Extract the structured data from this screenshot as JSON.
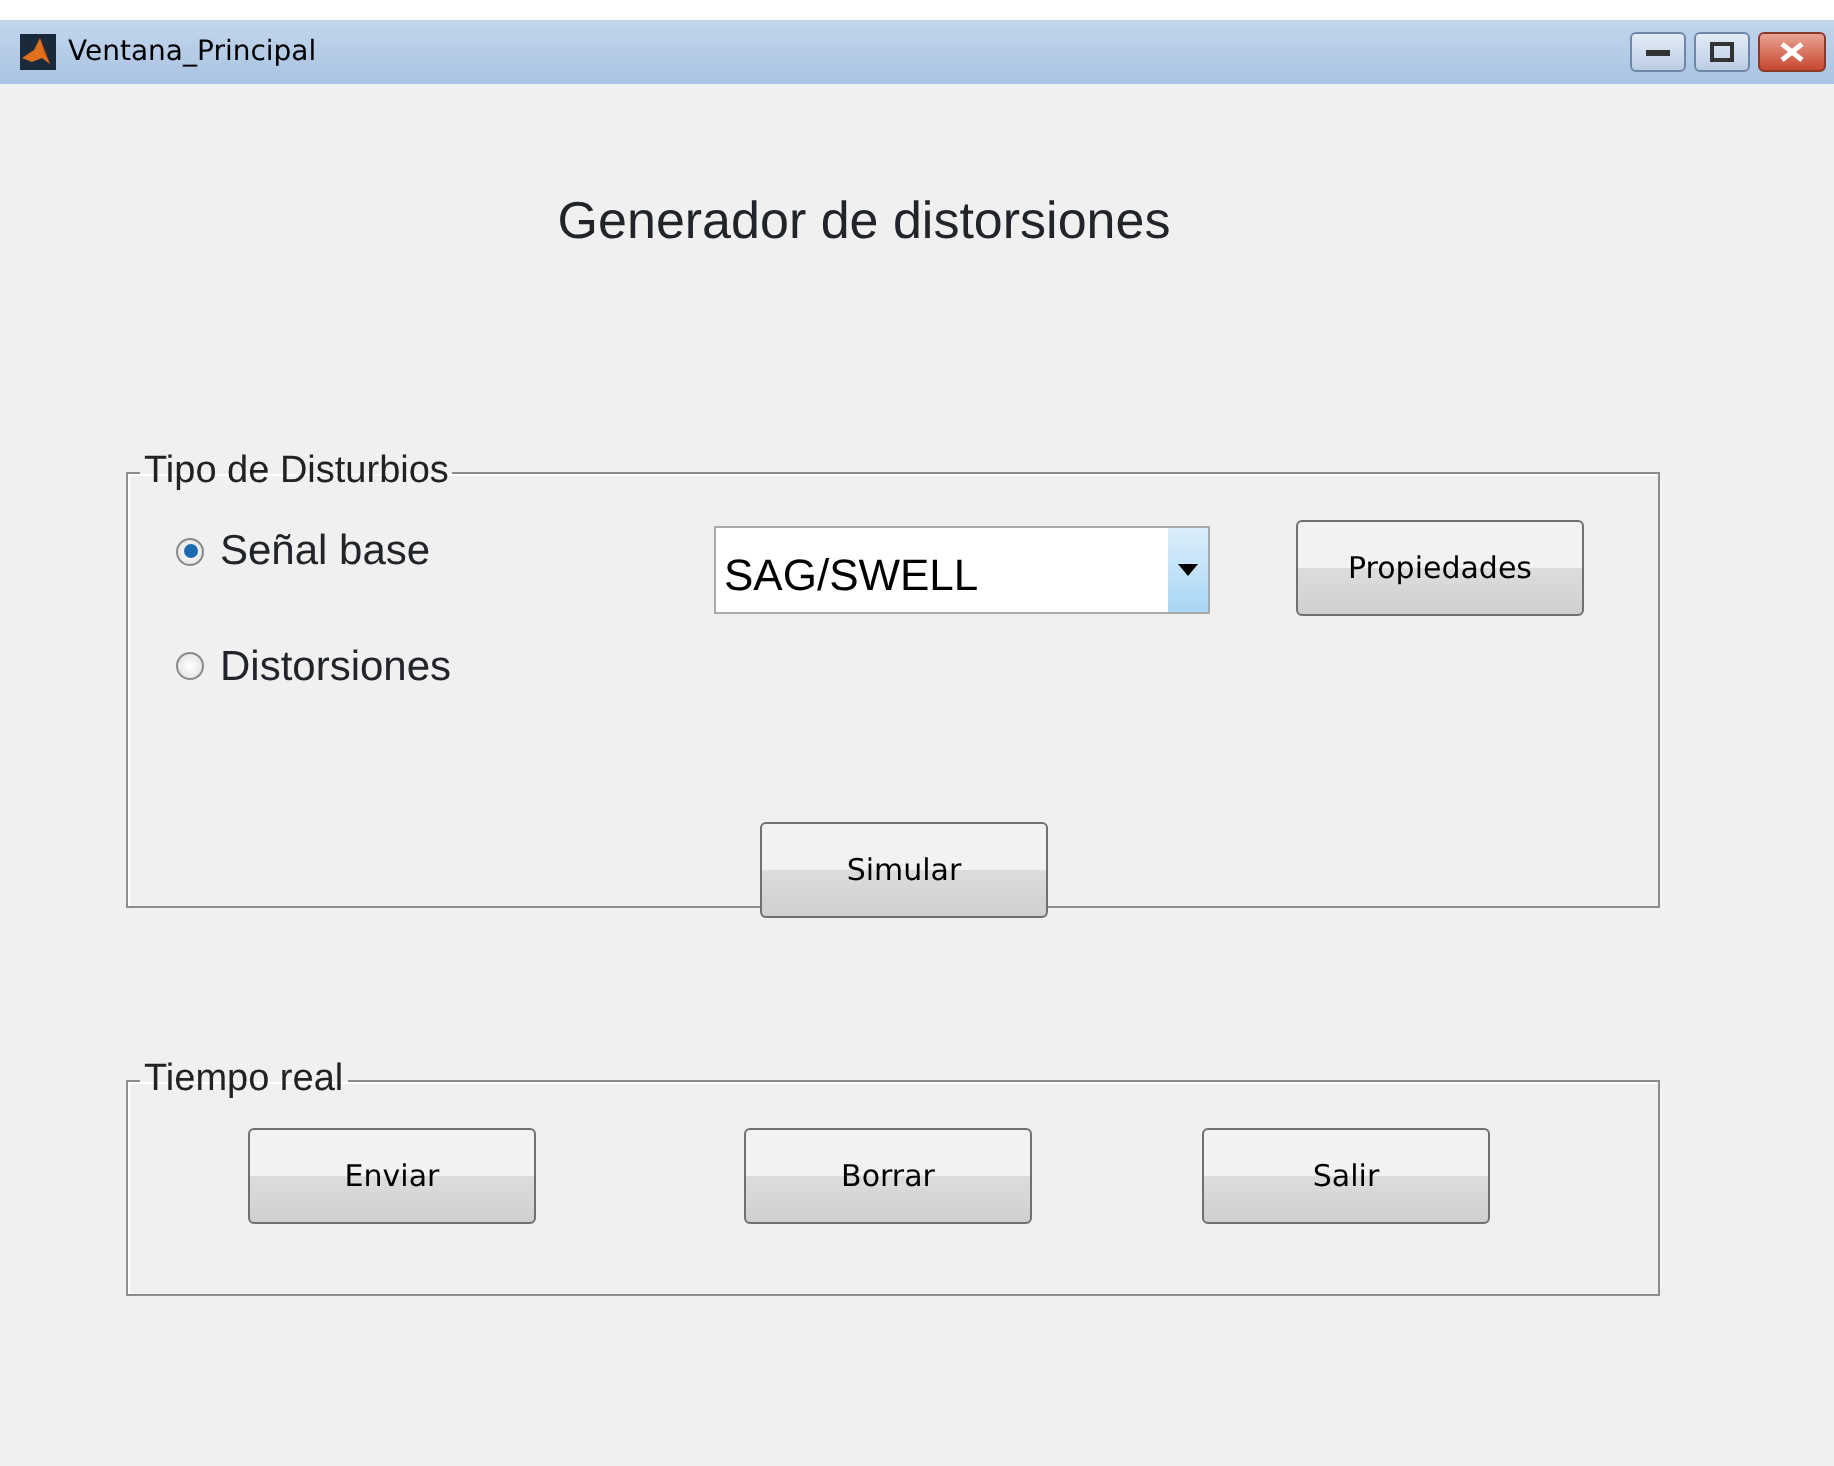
{
  "window": {
    "title": "Ventana_Principal"
  },
  "heading": "Generador de distorsiones",
  "disturbance_panel": {
    "title": "Tipo de Disturbios",
    "radios": [
      {
        "label": "Señal base",
        "selected": true
      },
      {
        "label": "Distorsiones",
        "selected": false
      }
    ],
    "dropdown": {
      "value": "SAG/SWELL"
    },
    "properties_button": "Propiedades",
    "simulate_button": "Simular"
  },
  "realtime_panel": {
    "title": "Tiempo real",
    "buttons": [
      "Enviar",
      "Borrar",
      "Salir"
    ]
  }
}
